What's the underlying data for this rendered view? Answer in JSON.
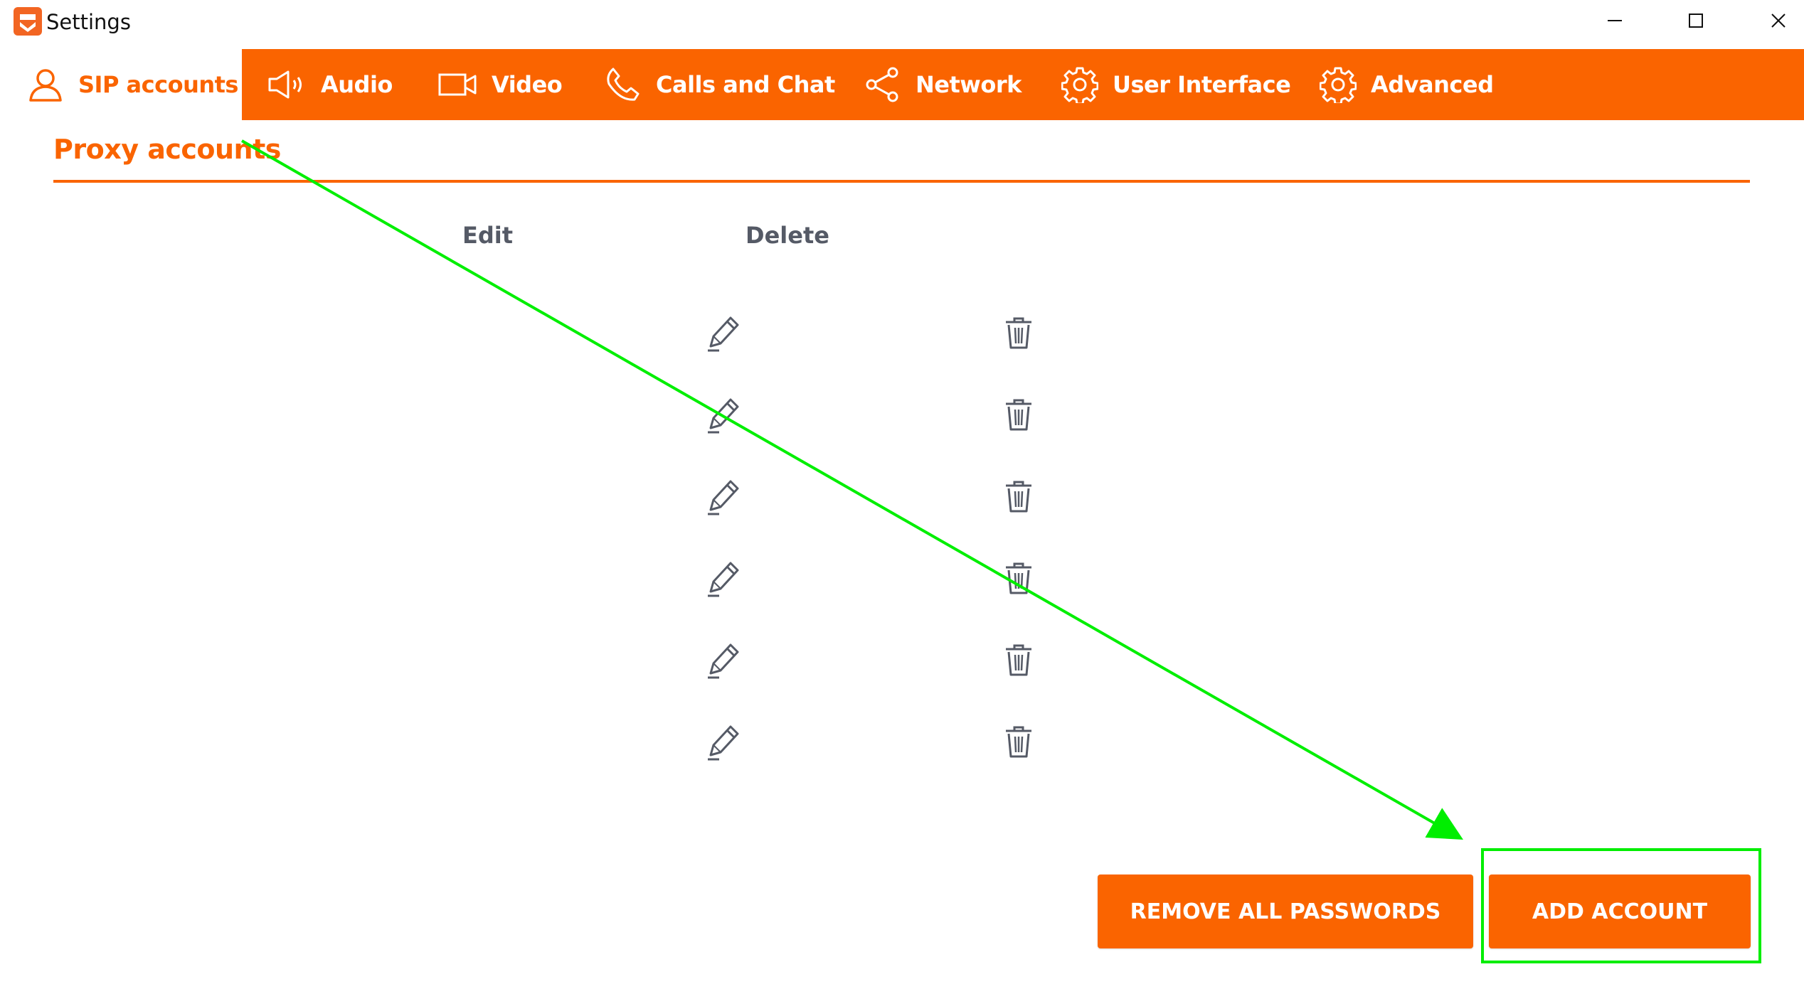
{
  "window": {
    "title": "Settings",
    "app_icon": "softphone-logo-icon",
    "controls": [
      "minimize-icon",
      "maximize-icon",
      "close-icon"
    ]
  },
  "tabs": [
    {
      "id": "sip",
      "label": "SIP accounts",
      "icon": "user-icon",
      "active": true
    },
    {
      "id": "audio",
      "label": "Audio",
      "icon": "speaker-icon",
      "active": false
    },
    {
      "id": "video",
      "label": "Video",
      "icon": "video-camera-icon",
      "active": false
    },
    {
      "id": "calls",
      "label": "Calls and Chat",
      "icon": "phone-icon",
      "active": false
    },
    {
      "id": "network",
      "label": "Network",
      "icon": "share-network-icon",
      "active": false
    },
    {
      "id": "ui",
      "label": "User Interface",
      "icon": "gear-icon",
      "active": false
    },
    {
      "id": "advanced",
      "label": "Advanced",
      "icon": "gear-icon",
      "active": false
    }
  ],
  "section": {
    "title": "Proxy accounts"
  },
  "table": {
    "columns": [
      "Edit",
      "Delete"
    ],
    "row_count": 6,
    "row_actions": [
      "pencil-icon",
      "trash-icon"
    ]
  },
  "buttons": {
    "remove_all_passwords": "REMOVE ALL PASSWORDS",
    "add_account": "ADD ACCOUNT"
  },
  "colors": {
    "accent": "#fa6400",
    "header_text": "#555a66",
    "annotation": "#00ee00"
  }
}
